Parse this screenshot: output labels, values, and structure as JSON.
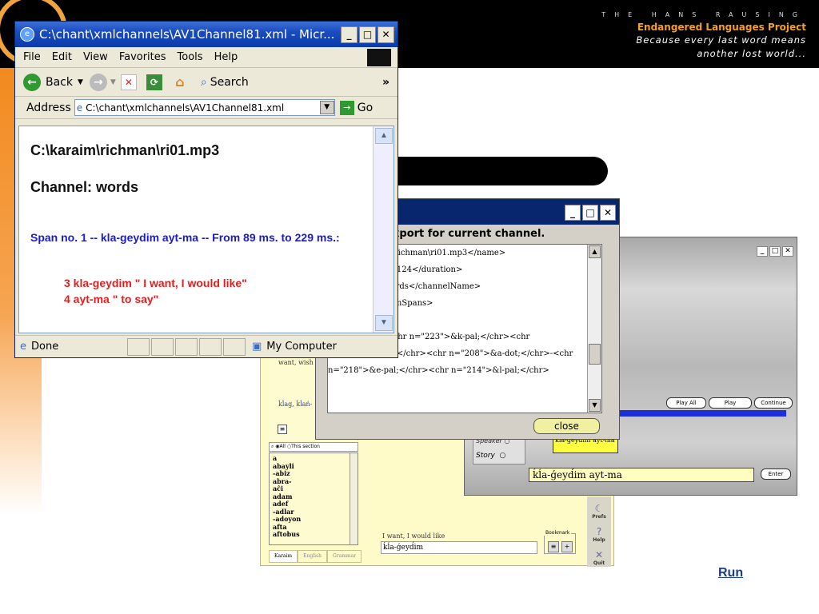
{
  "brand": {
    "line1": "THE HANS RAUSING",
    "line2": "Endangered Languages Project",
    "line3a": "Because every last word means",
    "line3b": "another lost world..."
  },
  "run_link": "Run",
  "colors": {
    "accent_orange": "#f28a1e",
    "ie_title_blue": "#0a3aab",
    "span_blue": "#1a1ad6",
    "annot_red": "#e02020"
  },
  "ie": {
    "title": "C:\\chant\\xmlchannels\\AV1Channel81.xml - Micr...",
    "menu": [
      "File",
      "Edit",
      "View",
      "Favorites",
      "Tools",
      "Help"
    ],
    "toolbar": {
      "back": "Back",
      "search": "Search",
      "more": "»"
    },
    "address_label": "Address",
    "address_value": "C:\\chant\\xmlchannels\\AV1Channel81.xml",
    "go_label": "Go",
    "content": {
      "file": "C:\\karaim\\richman\\ri01.mp3",
      "channel": "Channel: words",
      "span": "Span no. 1 -- kla-geydim ayt-ma -- From 89 ms. to 229 ms.:",
      "annot1": "3 kla-geydim \" I want, I would like\"",
      "annot2": "4 ayt-ma \" to say\""
    },
    "status_left": "Done",
    "status_right": "My Computer"
  },
  "xml_dialog": {
    "heading": "xport for current channel.",
    "lines": [
      "m\\richman\\ri01.mp3</name>",
      "3.2124</duration>",
      "",
      "words</channelName>",
      "numSpans>",
      "",
      "",
      "<annot>",
      "  <content><chr n=\"223\">&k-pal;</chr><chr",
      "n=\"224\">&l-pal;</chr><chr n=\"208\">&a-dot;</chr>-<chr",
      "n=\"218\">&e-pal;</chr><chr n=\"214\">&l-pal;</chr>"
    ],
    "close_label": "close"
  },
  "player": {
    "buttons": [
      "Play All",
      "Play Segment",
      "Continue"
    ],
    "speaker_label": "Speaker",
    "story_label": "Story",
    "segment_text": "kla-geydim ayt-ma",
    "input_text": "ḱĺa-ǵeyd́im ayt-ma",
    "enter_label": "Enter"
  },
  "karaim": {
    "gloss": "want, wish",
    "headword": "ḱĺag, ḱĺań-",
    "search_all": "All",
    "search_section": "This section",
    "words": [
      "a",
      "abayli",
      "-abiz",
      "abra-",
      "aĉi",
      "adam",
      "adef",
      "-adlar",
      "-adoyon",
      "afta",
      "aftobus"
    ],
    "tabs": [
      "Karaim",
      "English",
      "Grammar"
    ],
    "lower_label": "I want, I would like",
    "lower_input": "ḱĺa-ǵeyd́im",
    "bookmark_label": "Bookmark",
    "side": [
      "Prefs",
      "Help",
      "Quit"
    ]
  }
}
